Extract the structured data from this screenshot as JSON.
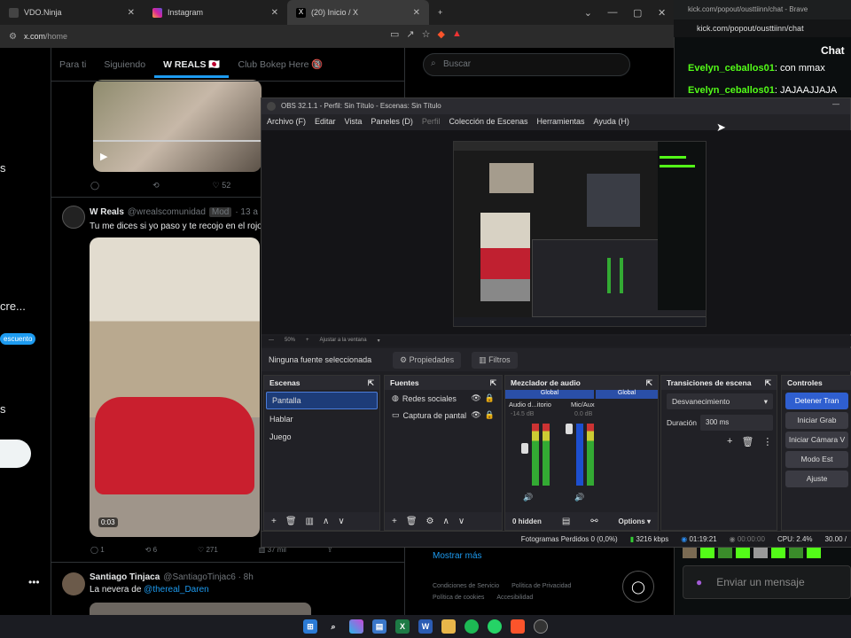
{
  "browser": {
    "tabs": [
      {
        "label": "VDO.Ninja",
        "color": "#3a3a3a"
      },
      {
        "label": "Instagram",
        "color": "#d6249f"
      },
      {
        "label": "(20) Inicio / X",
        "color": "#ffffff"
      }
    ],
    "url_host": "x.com",
    "url_path": "/home"
  },
  "x": {
    "tabs": [
      "Para ti",
      "Siguiendo",
      "W REALS 🇯🇵",
      "Club Bokep Here 🔞"
    ],
    "search_placeholder": "Buscar",
    "left_fragments": [
      "s",
      "cre...",
      "escuento",
      "s"
    ],
    "tweet1": {
      "actions": [
        "",
        "",
        "52"
      ]
    },
    "tweet2": {
      "name": "W Reals",
      "handle": "@wrealscomunidad",
      "badge": "Mod",
      "time": "· 13 a",
      "text": "Tu me dices si yo paso y te recojo en el rojo",
      "duration": "0:03",
      "actions": [
        "1",
        "6",
        "271",
        "37 mil"
      ]
    },
    "tweet3": {
      "name": "Santiago Tinjaca",
      "handle": "@SantiagoTinjac6 · 8h",
      "text_prefix": "La nevera de ",
      "mention": "@thereal_Daren"
    },
    "show_more": "Mostrar más",
    "footer": [
      "Condiciones de Servicio",
      "Política de Privacidad",
      "Política de cookies",
      "Accesibilidad"
    ]
  },
  "kick": {
    "titlebar": "kick.com/popout/ousttiinn/chat - Brave",
    "url": "kick.com/popout/ousttiinn/chat",
    "title": "Chat",
    "messages": [
      {
        "user": "Evelyn_ceballos01",
        "text": ": con mmax"
      },
      {
        "user": "Evelyn_ceballos01",
        "text": ": JAJAAJJAJA"
      }
    ],
    "input_placeholder": "Enviar un mensaje"
  },
  "obs": {
    "title": "OBS 32.1.1 - Perfil: Sin Título - Escenas: Sin Título",
    "menu": [
      "Archivo (F)",
      "Editar",
      "Vista",
      "Paneles (D)",
      "Perfil",
      "Colección de Escenas",
      "Herramientas",
      "Ayuda (H)"
    ],
    "zoom": "50%",
    "fit": "Ajustar a la ventana",
    "no_source": "Ninguna fuente seleccionada",
    "properties": "Propiedades",
    "filters": "Filtros",
    "scenes_title": "Escenas",
    "scenes": [
      "Pantalla",
      "Hablar",
      "Juego"
    ],
    "sources_title": "Fuentes",
    "sources": [
      "Redes sociales",
      "Captura de pantal"
    ],
    "mixer_title": "Mezclador de audio",
    "mixer_channels": [
      {
        "group": "Global",
        "name": "Audio d...itorio",
        "db": "-14.5 dB"
      },
      {
        "group": "Global",
        "name": "Mic/Aux",
        "db": "0.0 dB"
      }
    ],
    "mixer_hidden": "0 hidden",
    "mixer_options": "Options",
    "transitions_title": "Transiciones de escena",
    "transition": "Desvanecimiento",
    "duration_label": "Duración",
    "duration_value": "300 ms",
    "controls_title": "Controles",
    "controls": [
      "Detener Tran",
      "Iniciar Grab",
      "Iniciar Cámara V",
      "Modo Est",
      "Ajuste"
    ],
    "status": {
      "frames": "Fotogramas Perdidos 0 (0,0%)",
      "kbps": "3216 kbps",
      "time": "01:19:21",
      "rec": "00:00:00",
      "cpu": "CPU: 2.4%",
      "fps": "30.00 /"
    }
  },
  "taskbar": [
    "windows",
    "search",
    "copilot",
    "store",
    "excel",
    "word",
    "folder",
    "spotify",
    "whatsapp",
    "brave",
    "obs"
  ]
}
